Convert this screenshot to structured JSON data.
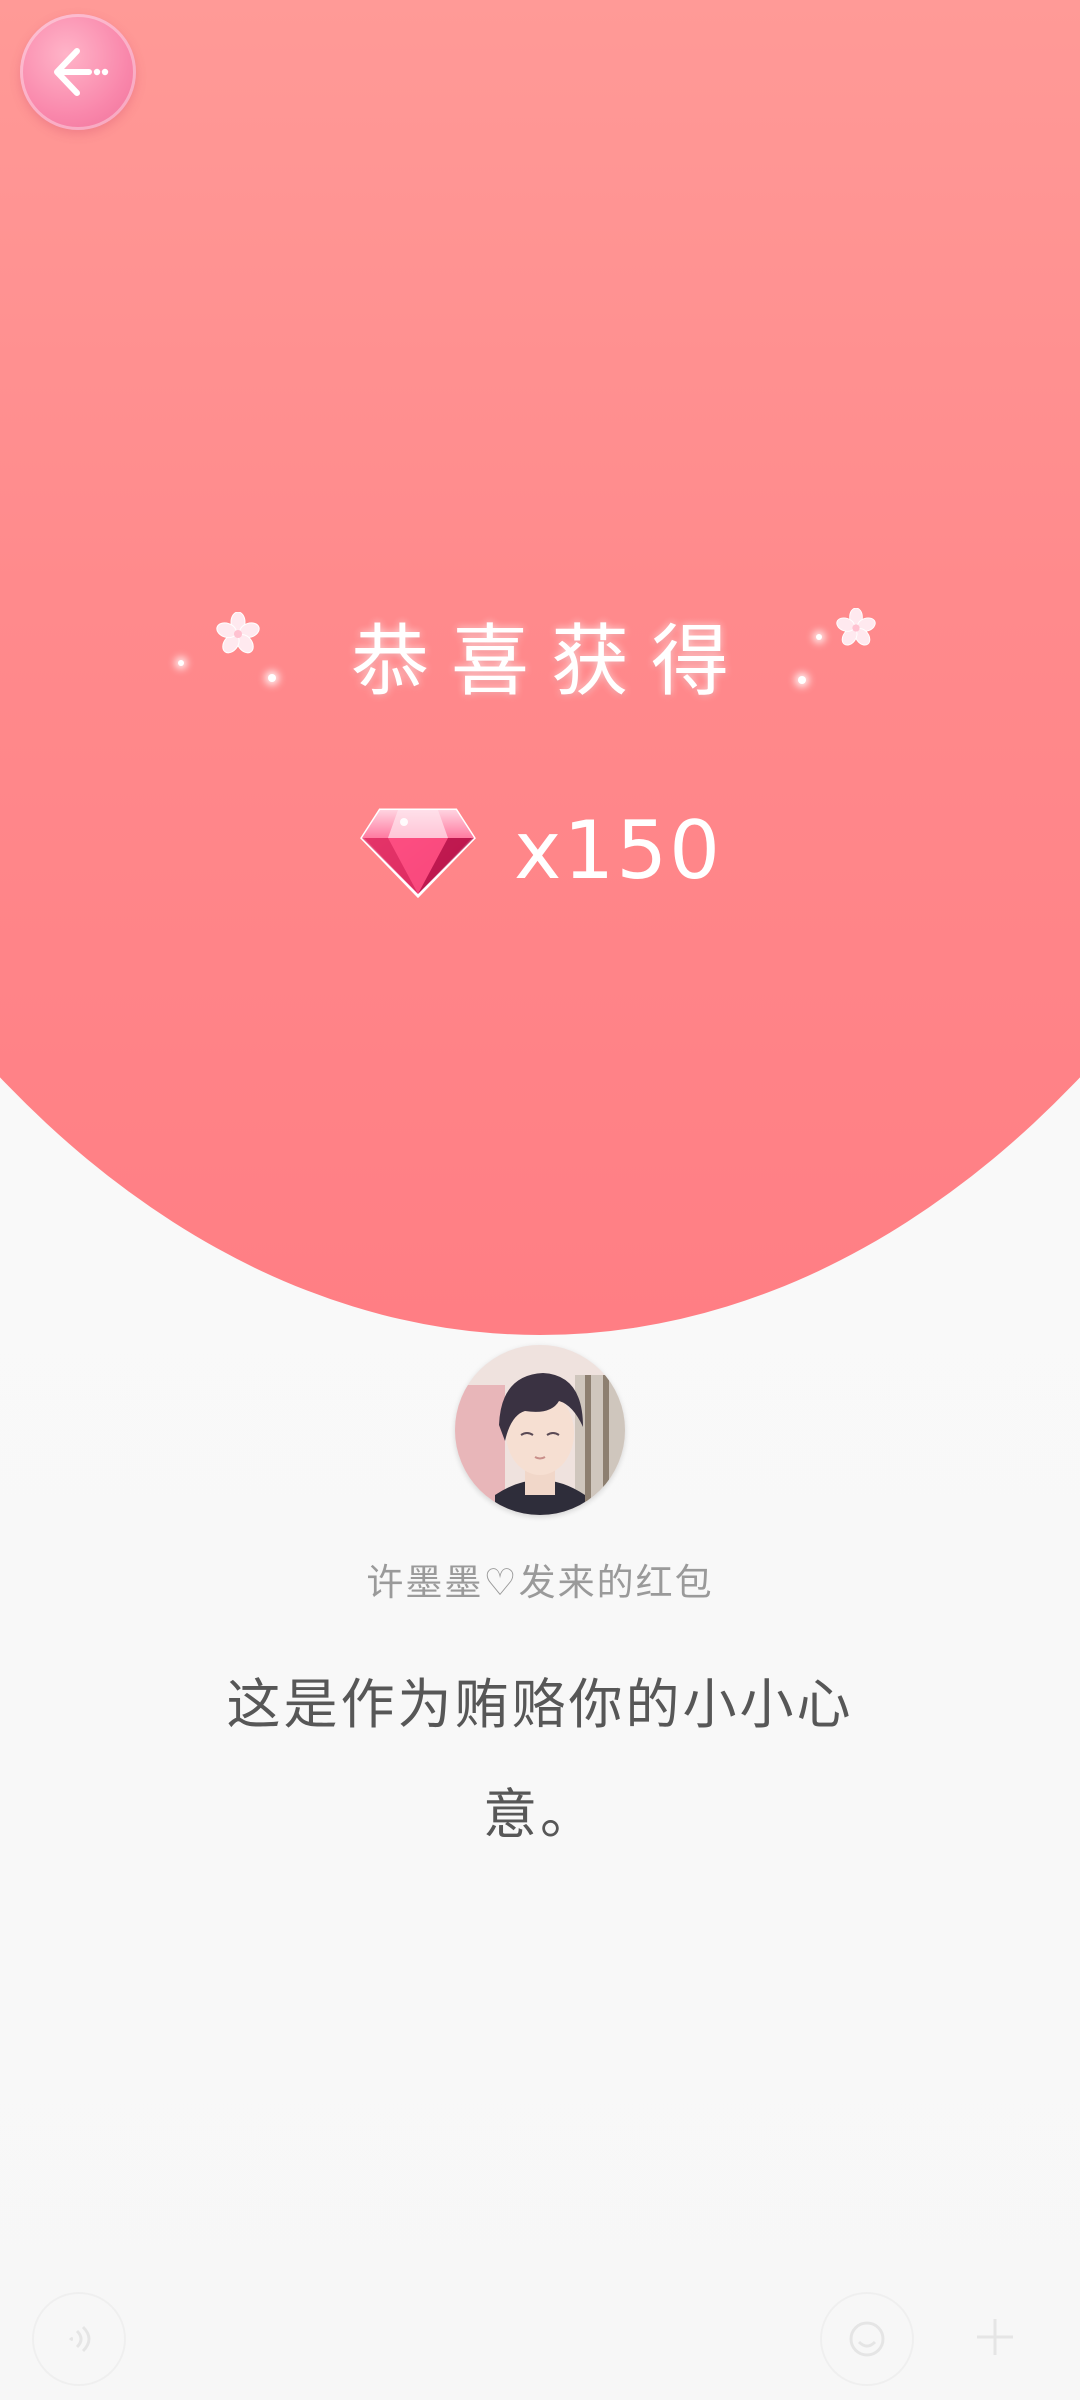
{
  "header": {
    "back_icon": "back-arrow-icon"
  },
  "reward": {
    "title": "恭喜获得",
    "item_icon": "diamond-icon",
    "count": "x150",
    "decorations": [
      "sakura-flower-icon",
      "sparkle-icon"
    ]
  },
  "sender": {
    "avatar_icon": "avatar",
    "label": "许墨墨♡发来的红包"
  },
  "message": {
    "text": "这是作为贿赂你的小小心意。"
  },
  "input_bar": {
    "voice_icon": "voice-icon",
    "emoji_icon": "emoji-icon",
    "plus_icon": "plus-icon"
  },
  "colors": {
    "hero_top": "#ff9a97",
    "hero_bottom": "#ff7e84",
    "back_button": "#f987ab",
    "background": "#f9f9f9",
    "message_text": "#575757",
    "sender_text": "#9a9a9a"
  }
}
